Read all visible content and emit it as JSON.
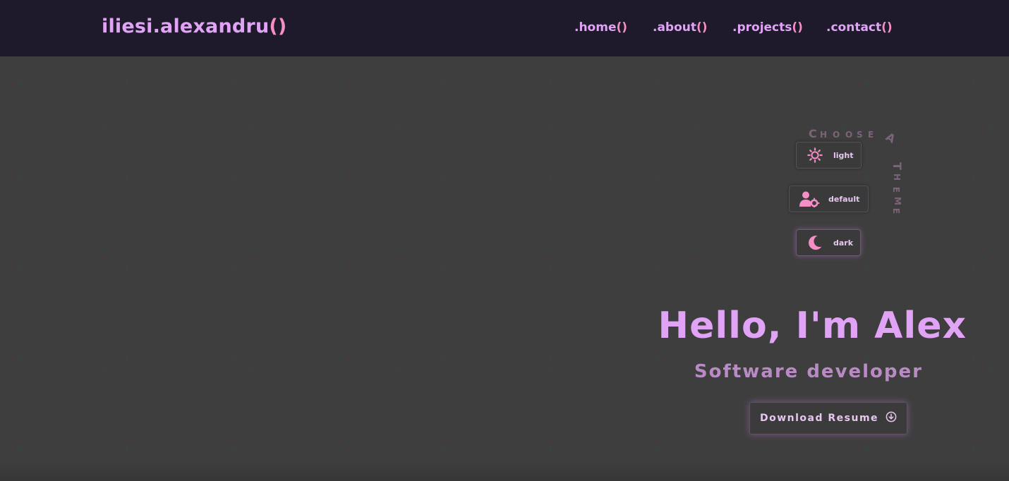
{
  "header": {
    "brand_name": "iliesi.alexandru",
    "brand_parens": "()",
    "nav": [
      {
        "name": ".home",
        "parens": "()"
      },
      {
        "name": ".about",
        "parens": "()"
      },
      {
        "name": ".projects",
        "parens": "()"
      },
      {
        "name": ".contact",
        "parens": "()"
      }
    ]
  },
  "theme_chooser": {
    "caption": "Choose A Theme",
    "options": [
      {
        "label": "light",
        "icon": "sun-icon"
      },
      {
        "label": "default",
        "icon": "user-gear-icon"
      },
      {
        "label": "dark",
        "icon": "moon-icon"
      }
    ],
    "selected": "dark"
  },
  "hero": {
    "title": "Hello, I'm Alex",
    "subtitle": "Software developer",
    "resume_button": "Download Resume",
    "resume_icon": "download-circle-icon"
  },
  "colors": {
    "header_bg": "#1e1a2c",
    "page_bg": "#3e3e3e",
    "accent_purple": "#e0a3f5",
    "accent_pink": "#f48ec4",
    "muted": "#b98bc4"
  }
}
